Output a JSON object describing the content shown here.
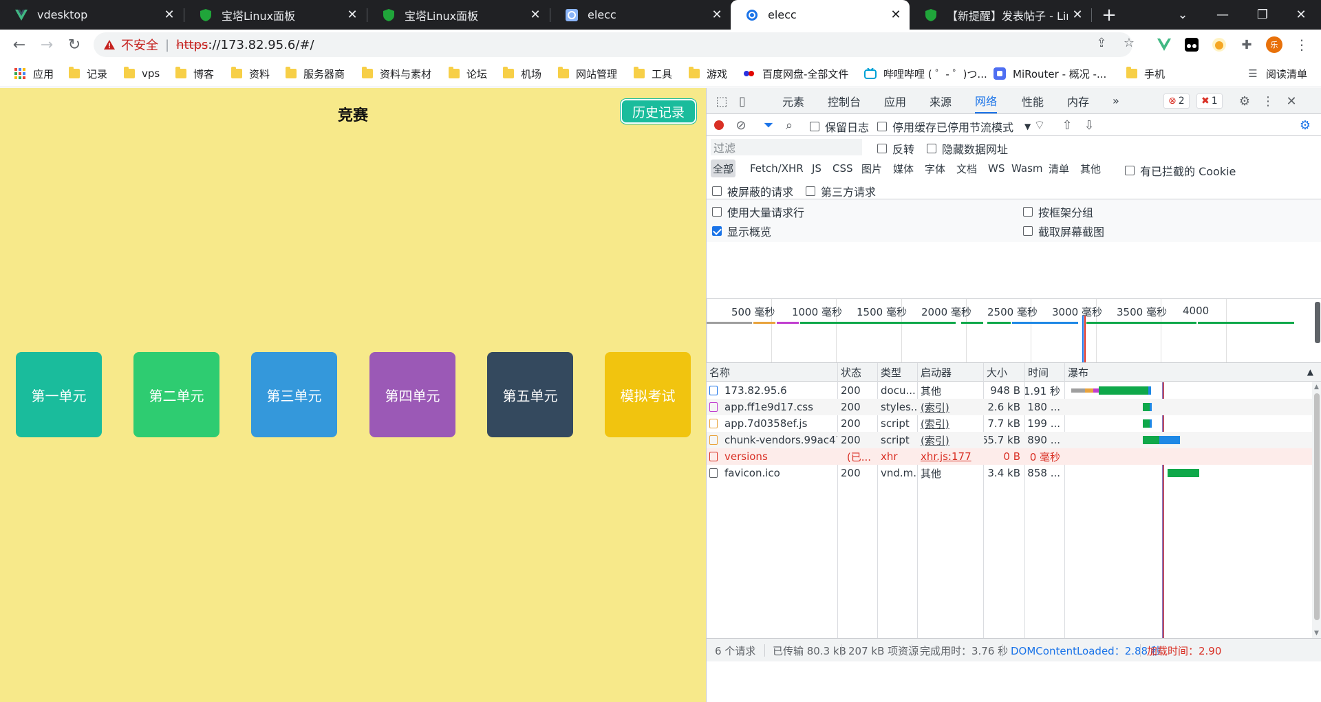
{
  "tabs": [
    {
      "title": "vdesktop",
      "icon": "vue-icon"
    },
    {
      "title": "宝塔Linux面板",
      "icon": "shield-icon"
    },
    {
      "title": "宝塔Linux面板",
      "icon": "shield-icon"
    },
    {
      "title": "elecc",
      "icon": "globe-icon"
    },
    {
      "title": "elecc",
      "icon": "globe-icon",
      "active": true
    },
    {
      "title": "【新提醒】发表帖子 - Linu",
      "icon": "shield-icon"
    }
  ],
  "toolbar": {
    "insecure_label": "不安全",
    "url_scheme": "https",
    "url_rest": "://173.82.95.6/#/"
  },
  "bookmarks": [
    {
      "label": "应用",
      "icon": "apps-grid-icon"
    },
    {
      "label": "记录",
      "icon": "folder-icon"
    },
    {
      "label": "vps",
      "icon": "folder-icon"
    },
    {
      "label": "博客",
      "icon": "folder-icon"
    },
    {
      "label": "资料",
      "icon": "folder-icon"
    },
    {
      "label": "服务器商",
      "icon": "folder-icon"
    },
    {
      "label": "资料与素材",
      "icon": "folder-icon"
    },
    {
      "label": "论坛",
      "icon": "folder-icon"
    },
    {
      "label": "机场",
      "icon": "folder-icon"
    },
    {
      "label": "网站管理",
      "icon": "folder-icon"
    },
    {
      "label": "工具",
      "icon": "folder-icon"
    },
    {
      "label": "游戏",
      "icon": "folder-icon"
    },
    {
      "label": "百度网盘-全部文件",
      "icon": "baidu-icon"
    },
    {
      "label": "哔哩哔哩 ( ゜- ゜)つ...",
      "icon": "bilibili-icon"
    },
    {
      "label": "MiRouter - 概况 -...",
      "icon": "mirouter-icon"
    },
    {
      "label": "手机",
      "icon": "folder-icon"
    }
  ],
  "reading_list": "阅读清单",
  "page": {
    "title": "竞赛",
    "history_button": "历史记录",
    "units": [
      {
        "label": "第一单元",
        "color": "#1abc9c"
      },
      {
        "label": "第二单元",
        "color": "#2ecc71"
      },
      {
        "label": "第三单元",
        "color": "#3498db"
      },
      {
        "label": "第四单元",
        "color": "#9b59b6"
      },
      {
        "label": "第五单元",
        "color": "#34495e"
      },
      {
        "label": "模拟考试",
        "color": "#f1c40f"
      }
    ]
  },
  "devtools": {
    "tabs": [
      "元素",
      "控制台",
      "应用",
      "来源",
      "网络",
      "性能",
      "内存"
    ],
    "active_tab": "网络",
    "more": "»",
    "error_count": "2",
    "issue_count": "1",
    "preserve_log": "保留日志",
    "disable_cache": "停用缓存",
    "throttle": "已停用节流模式",
    "filter_placeholder": "过滤",
    "invert": "反转",
    "hide_data_urls": "隐藏数据网址",
    "filter_types": [
      "全部",
      "Fetch/XHR",
      "JS",
      "CSS",
      "图片",
      "媒体",
      "字体",
      "文档",
      "WS",
      "Wasm",
      "清单",
      "其他"
    ],
    "blocked_cookies": "有已拦截的 Cookie",
    "blocked_requests": "被屏蔽的请求",
    "third_party": "第三方请求",
    "big_rows": "使用大量请求行",
    "group_by_frame": "按框架分组",
    "show_overview": "显示概览",
    "capture_screenshots": "截取屏幕截图",
    "timeline_ticks": [
      "500 毫秒",
      "1000 毫秒",
      "1500 毫秒",
      "2000 毫秒",
      "2500 毫秒",
      "3000 毫秒",
      "3500 毫秒",
      "4000"
    ],
    "columns": [
      "名称",
      "状态",
      "类型",
      "启动器",
      "大小",
      "时间",
      "瀑布"
    ],
    "requests": [
      {
        "name": "173.82.95.6",
        "status": "200",
        "type": "docu...",
        "initiator": "其他",
        "size": "948 B",
        "time": "1.91 秒",
        "kind": "doc"
      },
      {
        "name": "app.ff1e9d17.css",
        "status": "200",
        "type": "styles...",
        "initiator": "(索引)",
        "size": "2.6 kB",
        "time": "180 ...",
        "kind": "css"
      },
      {
        "name": "app.7d0358ef.js",
        "status": "200",
        "type": "script",
        "initiator": "(索引)",
        "size": "7.7 kB",
        "time": "199 ...",
        "kind": "js"
      },
      {
        "name": "chunk-vendors.99ac47e5.js",
        "status": "200",
        "type": "script",
        "initiator": "(索引)",
        "size": "65.7 kB",
        "time": "890 ...",
        "kind": "js"
      },
      {
        "name": "versions",
        "status": "(已...",
        "type": "xhr",
        "initiator": "xhr.js:177",
        "size": "0 B",
        "time": "0 毫秒",
        "kind": "err"
      },
      {
        "name": "favicon.ico",
        "status": "200",
        "type": "vnd.m...",
        "initiator": "其他",
        "size": "3.4 kB",
        "time": "858 ...",
        "kind": "other"
      }
    ],
    "status": {
      "requests": "6 个请求",
      "transferred": "已传输 80.3 kB",
      "resources": "207 kB 项资源",
      "finish": "完成用时：3.76 秒",
      "dcl": "DOMContentLoaded：2.88 秒",
      "load": "加载时间：2.90"
    }
  }
}
